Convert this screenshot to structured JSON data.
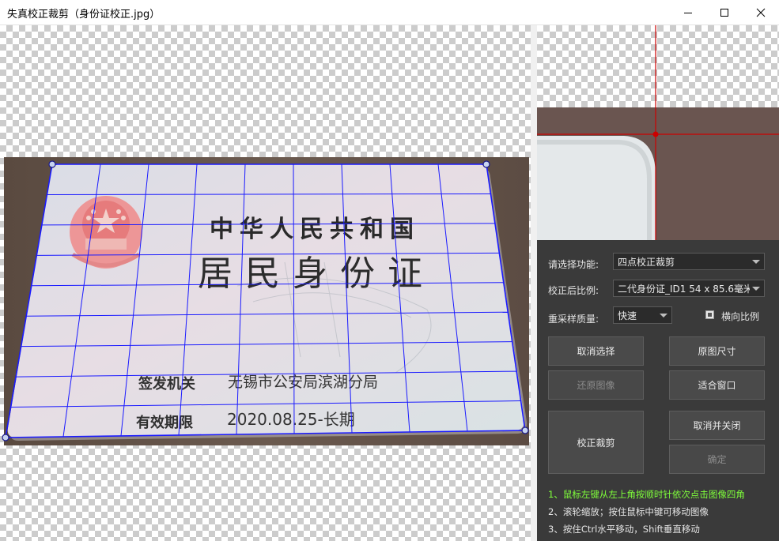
{
  "window": {
    "title": "失真校正裁剪（身份证校正.jpg）",
    "controls": [
      "minimize",
      "maximize",
      "close"
    ]
  },
  "card": {
    "title_line": "中华人民共和国",
    "main_line": "居民身份证",
    "authority_label": "签发机关",
    "authority_value": "无锡市公安局滨湖分局",
    "validity_label": "有效期限",
    "validity_value": "2020.08.25-长期"
  },
  "panel": {
    "function_label": "请选择功能:",
    "function_value": "四点校正裁剪",
    "ratio_label": "校正后比例:",
    "ratio_value": "二代身份证_ID1 54 x 85.6毫米",
    "quality_label": "重采样质量:",
    "quality_value": "快速",
    "landscape_label": "横向比例",
    "landscape_checked": true,
    "buttons": {
      "cancel_selection": "取消选择",
      "original_size": "原图尺寸",
      "restore_image": "还原图像",
      "fit_window": "适合窗口",
      "correct_crop": "校正裁剪",
      "cancel_close": "取消并关闭",
      "confirm": "确定"
    },
    "help": [
      "1、鼠标左键从左上角按顺时针依次点击图像四角",
      "2、滚轮缩放；按住鼠标中键可移动图像",
      "3、按住Ctrl水平移动，Shift垂直移动"
    ]
  },
  "colors": {
    "grid": "#1a1aff",
    "crosshair": "#cc0000",
    "help_highlight": "#7fff3a",
    "panel_bg": "#3a3a3a"
  }
}
